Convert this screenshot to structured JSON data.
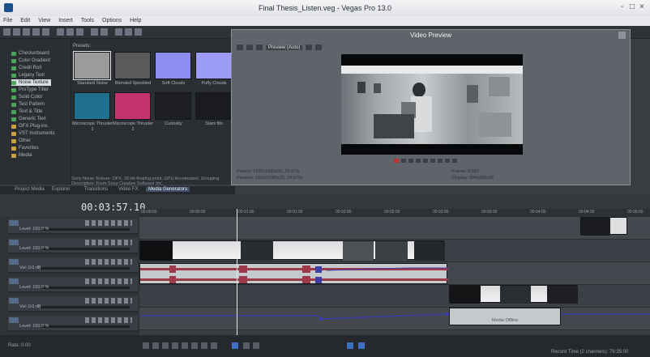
{
  "window": {
    "title": "Final Thesis_Listen.veg - Vegas Pro 13.0",
    "controls": {
      "minimize": "-",
      "maximize": "□",
      "close": "×"
    }
  },
  "menu": [
    "File",
    "Edit",
    "View",
    "Insert",
    "Tools",
    "Options",
    "Help"
  ],
  "explorer": {
    "items": [
      "Checkerboard",
      "Color Gradient",
      "Credit Roll",
      "Legacy Text",
      "Noise Texture",
      "ProType Titler",
      "Solid Color",
      "Test Pattern",
      "Text & Title",
      "Generic Text",
      "OFX Plug-ins",
      "VST Instruments",
      "Other",
      "Favorites",
      "Media"
    ],
    "selected_index": 4
  },
  "media": {
    "presets_label": "Presets:",
    "tiles": [
      {
        "label": "Standard Noise",
        "color": "#9b9b9b"
      },
      {
        "label": "Blended Speckled",
        "color": "#5a5a5a"
      },
      {
        "label": "Soft Clouds",
        "color": "#8d8df0"
      },
      {
        "label": "Puffy Clouds",
        "color": "#9d9cf5"
      },
      {
        "label": "Microscope Thruster 1",
        "color": "#1f6f8e"
      },
      {
        "label": "Microscope Thruster 2",
        "color": "#c2336f"
      },
      {
        "label": "Curiosity",
        "color": "#1e1f22"
      },
      {
        "label": "Stars fits",
        "color": "#1a1b1e"
      }
    ],
    "description": "Sony Noise Texture: OFX, 32-bit floating point, GPU Accelerated, Grouping Description: From Sony Creative Software Inc."
  },
  "tabs": [
    "Project Media",
    "Explorer",
    "Transitions",
    "Video FX",
    "Media Generators"
  ],
  "active_tab": "Media Generators",
  "preview": {
    "title": "Video Preview",
    "quality": "Preview (Auto)",
    "project": "Project: 1920x1080x32, 29.970i",
    "preview": "Preview: 1920x1080x32, 29.970p",
    "frame": "Frame: 6,569",
    "display": "Display: 504x283x32"
  },
  "timeline": {
    "time": "00:03:57.10",
    "ruler": [
      "00:00:00",
      "00:00:30",
      "00:01:00",
      "00:01:30",
      "00:02:00",
      "00:02:30",
      "00:03:00",
      "00:03:30",
      "00:04:00",
      "00:04:30",
      "00:05:00"
    ],
    "tracks": [
      {
        "level": "Level: 100.0 %"
      },
      {
        "level": "Level: 100.0 %"
      },
      {
        "level": "Vol: 0.0 dB"
      },
      {
        "level": "Level: 100.0 %"
      },
      {
        "level": "Vol: 0.0 dB"
      },
      {
        "level": "Level: 100.0 %"
      }
    ],
    "clip_label": "Media Offline"
  },
  "status": {
    "rate": "Rate: 0.00",
    "record_time": "Record Time (2 channels): 76:35:00"
  }
}
